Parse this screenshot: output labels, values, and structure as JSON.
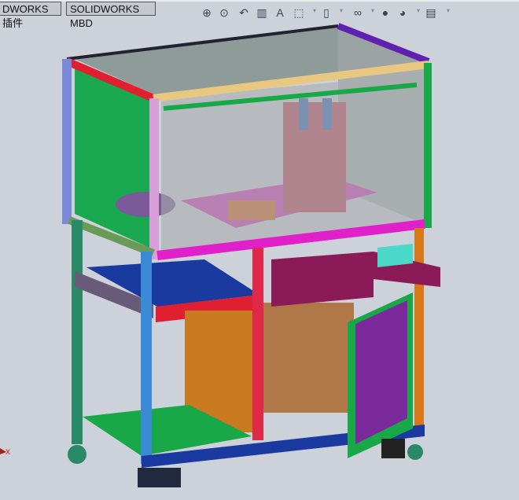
{
  "tabs": [
    {
      "label": "DWORKS 插件"
    },
    {
      "label": "SOLIDWORKS MBD"
    }
  ],
  "toolbar": [
    {
      "icon": "zoom-to-fit-icon",
      "glyph": "⊕"
    },
    {
      "icon": "zoom-to-area-icon",
      "glyph": "⊙"
    },
    {
      "icon": "previous-view-icon",
      "glyph": "↶"
    },
    {
      "icon": "section-view-icon",
      "glyph": "▥"
    },
    {
      "icon": "dynamic-annotation-icon",
      "glyph": "A"
    },
    {
      "icon": "view-orientation-icon",
      "glyph": "⬚"
    },
    {
      "icon": "display-style-icon",
      "glyph": "▯"
    },
    {
      "icon": "hide-show-items-icon",
      "glyph": "∞"
    },
    {
      "icon": "edit-appearance-icon",
      "glyph": "●"
    },
    {
      "icon": "apply-scene-icon",
      "glyph": "◕"
    },
    {
      "icon": "view-settings-icon",
      "glyph": "▤"
    }
  ],
  "triad": {
    "axis_label": "X"
  },
  "colors": {
    "background": "#cdd1d9",
    "magenta": "#e020c8",
    "green": "#18a848",
    "teal": "#2a8a68",
    "purple": "#7a2a9a",
    "orange": "#d07818"
  }
}
